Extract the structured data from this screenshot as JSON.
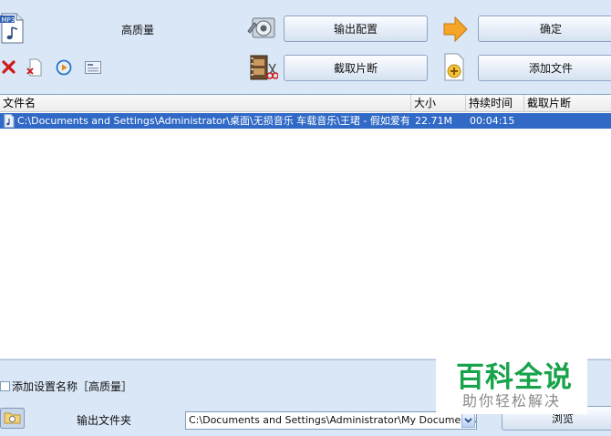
{
  "toolbar": {
    "quality_label": "高质量",
    "output_config_label": "输出配置",
    "ok_label": "确定",
    "cut_clip_label": "截取片断",
    "add_file_label": "添加文件",
    "icons": [
      "mp3-file-icon",
      "delete-icon",
      "remove-file-icon",
      "play-icon",
      "info-icon",
      "settings-icon",
      "film-cut-icon",
      "arrow-right-icon",
      "add-file-icon"
    ]
  },
  "file_table": {
    "columns": [
      "文件名",
      "大小",
      "持续时间",
      "截取片断"
    ],
    "rows": [
      {
        "name": "C:\\Documents and Settings\\Administrator\\桌面\\无损音乐 车载音乐\\王珺 - 假如爱有…",
        "size": "22.71M",
        "duration": "00:04:15",
        "clip": ""
      }
    ]
  },
  "bottom": {
    "add_setting_name_label": "添加设置名称［高质量］",
    "output_folder_label": "输出文件夹",
    "output_path": "C:\\Documents and Settings\\Administrator\\My Documents\\FFO",
    "browse_label": "浏览"
  },
  "watermark": {
    "title": "百科全说",
    "subtitle": "助你轻松解决"
  },
  "colors": {
    "panel_bg": "#d9e7f7",
    "selection": "#3169c6",
    "watermark_green": "#16a34a"
  }
}
